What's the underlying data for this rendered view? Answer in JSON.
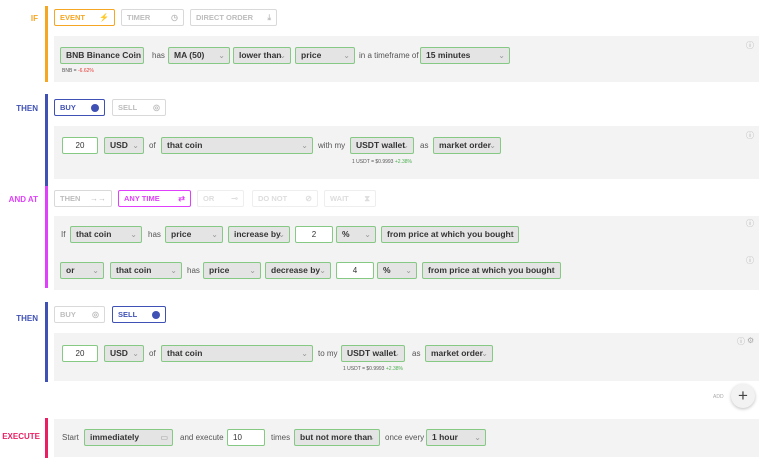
{
  "if_section": {
    "label": "IF",
    "tabs": [
      {
        "label": "EVENT",
        "icon": "lightning-icon"
      },
      {
        "label": "TIMER",
        "icon": "clock-icon"
      },
      {
        "label": "DIRECT ORDER",
        "icon": "download-icon"
      }
    ],
    "row": {
      "coin": "BNB Binance Coin",
      "has": "has",
      "indicator": "MA (50)",
      "comparison": "lower than",
      "target": "price",
      "timeframe_text": "in a timeframe of",
      "timeframe": "15 minutes",
      "note_prefix": "BNB = ",
      "note_value": "-6.62%"
    }
  },
  "then1": {
    "label": "THEN",
    "tabs": [
      {
        "label": "BUY"
      },
      {
        "label": "SELL"
      }
    ],
    "row": {
      "amount": "20",
      "currency": "USD",
      "of": "of",
      "coin": "that coin",
      "with_my": "with my",
      "wallet": "USDT wallet",
      "as": "as",
      "order": "market order",
      "note_prefix": "1 USDT = $0.9993 ",
      "note_value": "+2.38%"
    }
  },
  "and_at": {
    "label": "AND AT",
    "tabs": [
      {
        "label": "THEN"
      },
      {
        "label": "ANY TIME"
      },
      {
        "label": "OR"
      },
      {
        "label": "DO NOT"
      },
      {
        "label": "WAIT"
      }
    ],
    "row1": {
      "if": "If",
      "coin": "that coin",
      "has": "has",
      "target": "price",
      "change": "increase by",
      "value": "2",
      "unit": "%",
      "reference": "from price at which you bought"
    },
    "row2": {
      "connector": "or",
      "coin": "that coin",
      "has": "has",
      "target": "price",
      "change": "decrease by",
      "value": "4",
      "unit": "%",
      "reference": "from price at which you bought"
    }
  },
  "then2": {
    "label": "THEN",
    "tabs": [
      {
        "label": "BUY"
      },
      {
        "label": "SELL"
      }
    ],
    "row": {
      "amount": "20",
      "currency": "USD",
      "of": "of",
      "coin": "that coin",
      "to_my": "to my",
      "wallet": "USDT wallet",
      "as": "as",
      "order": "market order",
      "note_prefix": "1 USDT = $0.9993 ",
      "note_value": "+2.38%"
    },
    "add_label": "ADD"
  },
  "execute": {
    "label": "EXECUTE",
    "start": "Start",
    "start_value": "immediately",
    "and_execute": "and execute",
    "times_value": "10",
    "times": "times",
    "limit": "but not more than",
    "once_every": "once every",
    "interval": "1 hour"
  },
  "colors": {
    "if": "#f5a623",
    "then": "#3f51b5",
    "and_at": "#e040fb",
    "execute": "#e91e63",
    "border_green": "#85c985"
  }
}
